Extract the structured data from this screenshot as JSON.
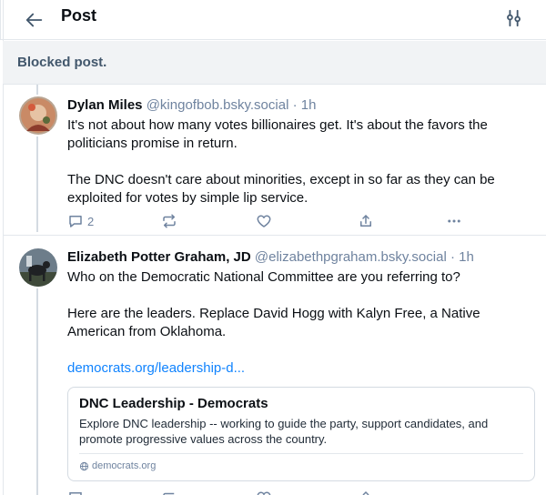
{
  "header": {
    "title": "Post"
  },
  "blocked": {
    "text": "Blocked post."
  },
  "posts": [
    {
      "author": "Dylan Miles",
      "handle": "@kingofbob.bsky.social",
      "time": "· 1h",
      "paragraphs": [
        "It's not about how many votes billionaires get. It's about the favors the politicians promise in return.",
        "The DNC doesn't care about minorities, except in so far as they can be exploited for votes by simple lip service."
      ],
      "reply_count": "2"
    },
    {
      "author": "Elizabeth Potter Graham, JD",
      "handle": "@elizabethpgraham.bsky.social",
      "time": "· 1h",
      "paragraphs": [
        "Who on the Democratic National Committee are you referring to?",
        "Here are the leaders. Replace David Hogg with Kalyn Free, a Native American from Oklahoma."
      ],
      "link_text": "democrats.org/leadership-d...",
      "embed": {
        "title": "DNC Leadership - Democrats",
        "description": "Explore DNC leadership -- working to guide the party, support candidates, and promote progressive values across the country.",
        "domain": "democrats.org"
      }
    }
  ],
  "icons": {
    "back": "arrow-left-icon",
    "settings": "sliders-icon",
    "reply": "speech-bubble-icon",
    "repost": "repost-icon",
    "like": "heart-icon",
    "share": "share-icon",
    "more": "ellipsis-icon",
    "globe": "globe-icon"
  },
  "colors": {
    "accent": "#1083fe",
    "muted": "#6f839f",
    "blocked_bg": "#f1f3f5"
  }
}
